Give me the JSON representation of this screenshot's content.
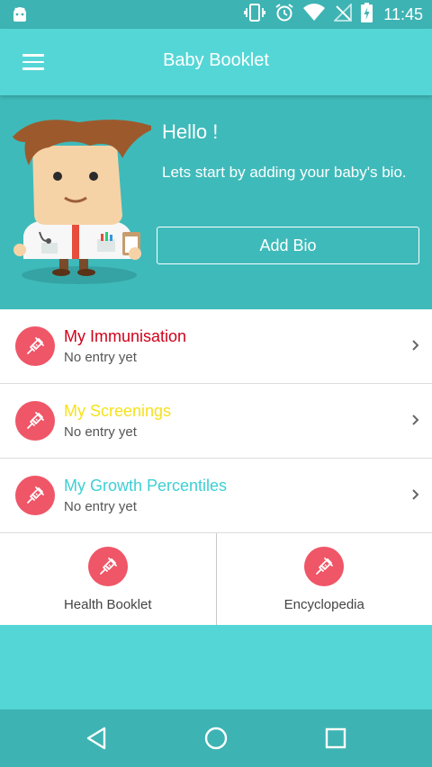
{
  "status_bar": {
    "time": "11:45"
  },
  "app_bar": {
    "title": "Baby Booklet",
    "menu_icon": "hamburger-menu-icon"
  },
  "hero": {
    "greeting": "Hello !",
    "message": "Lets start by adding your baby's bio.",
    "add_bio_label": "Add Bio"
  },
  "list": [
    {
      "title": "My Immunisation",
      "subtitle": "No entry yet",
      "title_color": "#d0021b",
      "icon": "syringe-icon"
    },
    {
      "title": "My Screenings",
      "subtitle": "No entry yet",
      "title_color": "#f5e21b",
      "icon": "syringe-icon"
    },
    {
      "title": "My Growth Percentiles",
      "subtitle": "No entry yet",
      "title_color": "#3ecfd4",
      "icon": "syringe-icon"
    }
  ],
  "tiles": [
    {
      "label": "Health Booklet",
      "icon": "syringe-icon"
    },
    {
      "label": "Encyclopedia",
      "icon": "syringe-icon"
    }
  ],
  "colors": {
    "primary": "#55d6d6",
    "primary_dark": "#3eb3b3",
    "hero_bg": "#3fbaba",
    "accent": "#ef5667"
  },
  "nav": {
    "back_icon": "back-triangle-icon",
    "home_icon": "home-circle-icon",
    "recents_icon": "recents-square-icon"
  }
}
